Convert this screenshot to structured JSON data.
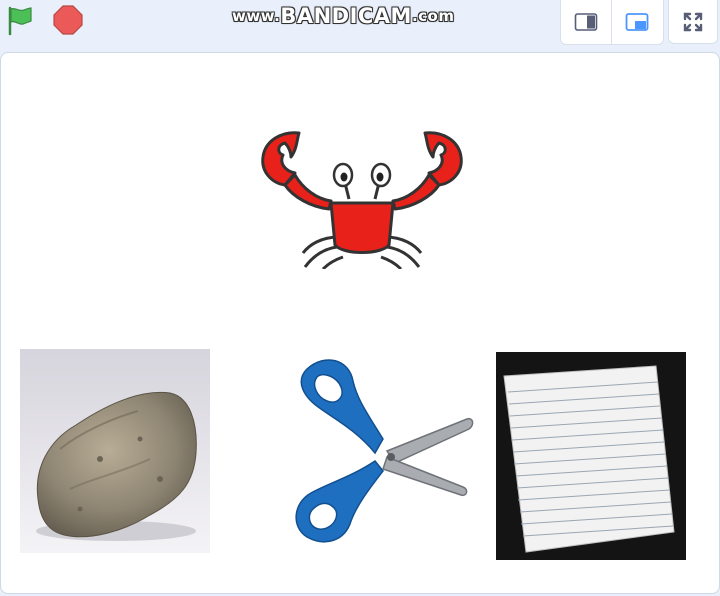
{
  "toolbar": {
    "watermark_prefix": "www.",
    "watermark_brand": "BANDICAM",
    "watermark_suffix": ".com",
    "green_flag": "green-flag-icon",
    "stop": "stop-icon",
    "small_stage": "small-stage-icon",
    "normal_stage": "normal-stage-icon",
    "fullscreen": "fullscreen-icon"
  },
  "colors": {
    "flag_green": "#4cbf56",
    "stop_red": "#ec5959",
    "accent_blue": "#4c97ff",
    "crab_red": "#e8221b",
    "scissors_blue": "#1f6fc0"
  },
  "stage": {
    "sprites": [
      "crab",
      "rock",
      "scissors",
      "paper"
    ]
  }
}
